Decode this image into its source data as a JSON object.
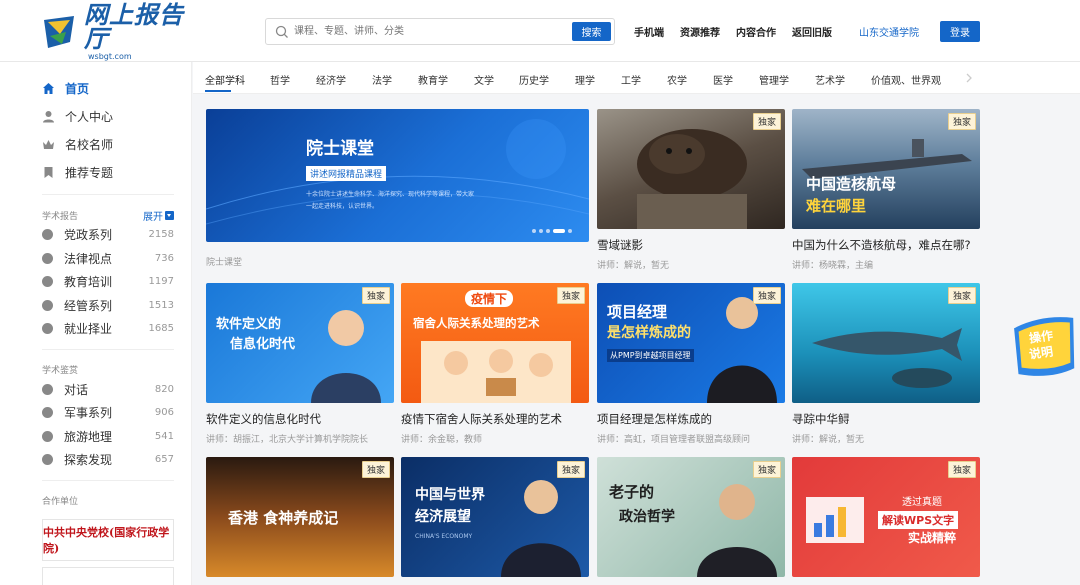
{
  "header": {
    "logo_cn": "网上报告厅",
    "logo_en": "wsbgt.com",
    "search_placeholder": "课程、专题、讲师、分类",
    "search_button": "搜索",
    "nav": [
      "手机端",
      "资源推荐",
      "内容合作",
      "返回旧版"
    ],
    "school": "山东交通学院",
    "login": "登录"
  },
  "sidebar": {
    "main": [
      {
        "label": "首页",
        "icon": "home-icon",
        "active": true
      },
      {
        "label": "个人中心",
        "icon": "user-icon",
        "active": false
      },
      {
        "label": "名校名师",
        "icon": "crown-icon",
        "active": false
      },
      {
        "label": "推荐专题",
        "icon": "bookmark-icon",
        "active": false
      }
    ],
    "section1": {
      "title": "学术报告",
      "expand": "展开",
      "items": [
        {
          "label": "党政系列",
          "count": "2158"
        },
        {
          "label": "法律视点",
          "count": "736"
        },
        {
          "label": "教育培训",
          "count": "1197"
        },
        {
          "label": "经管系列",
          "count": "1513"
        },
        {
          "label": "就业择业",
          "count": "1685"
        }
      ]
    },
    "section2": {
      "title": "学术鉴赏",
      "items": [
        {
          "label": "对话",
          "count": "820"
        },
        {
          "label": "军事系列",
          "count": "906"
        },
        {
          "label": "旅游地理",
          "count": "541"
        },
        {
          "label": "探索发现",
          "count": "657"
        }
      ]
    },
    "partners_title": "合作单位",
    "partner_logo_text": "中共中央党校(国家行政学院)"
  },
  "categories": [
    "全部学科",
    "哲学",
    "经济学",
    "法学",
    "教育学",
    "文学",
    "历史学",
    "理学",
    "工学",
    "农学",
    "医学",
    "管理学",
    "艺术学",
    "价值观、世界观"
  ],
  "banner": {
    "title": "院士课堂",
    "subtitle": "讲述网报精品课程",
    "desc1": "十余位院士讲述生命科学、海洋探究、现代科学等课程，带大家",
    "desc2": "一起走进科技，认识世界。",
    "caption": "院士课堂"
  },
  "badge": "独家",
  "cards": [
    {
      "title": "雪域谜影",
      "meta": "讲师：解说，暂无",
      "thumb_text": ""
    },
    {
      "title": "中国为什么不造核航母，难点在哪?",
      "meta": "讲师：杨晓霖，主编",
      "thumb_text1": "中国造核航母",
      "thumb_text2": "难在哪里"
    },
    {
      "title": "软件定义的信息化时代",
      "meta": "讲师：胡振江，北京大学计算机学院院长",
      "thumb_text1": "软件定义的",
      "thumb_text2": "信息化时代"
    },
    {
      "title": "疫情下宿舍人际关系处理的艺术",
      "meta": "讲师：余金聪，教师",
      "thumb_text1": "疫情下",
      "thumb_text2": "宿舍人际关系处理的艺术"
    },
    {
      "title": "项目经理是怎样炼成的",
      "meta": "讲师：高虹，项目管理者联盟高级顾问",
      "thumb_text1": "项目经理",
      "thumb_text2": "是怎样炼成的",
      "thumb_text3": "从PMP到卓越项目经理"
    },
    {
      "title": "寻踪中华鲟",
      "meta": "讲师：解说，暂无",
      "thumb_text": ""
    },
    {
      "thumb_text1": "香港 食神养成记"
    },
    {
      "thumb_text1": "中国与世界",
      "thumb_text2": "经济展望",
      "thumb_text3": "CHINA'S ECONOMY"
    },
    {
      "thumb_text1": "老子的",
      "thumb_text2": "政治哲学"
    },
    {
      "thumb_text1": "透过真题",
      "thumb_text2": "解读WPS文字",
      "thumb_text3": "实战精粹"
    }
  ],
  "help_text1": "操作",
  "help_text2": "说明"
}
